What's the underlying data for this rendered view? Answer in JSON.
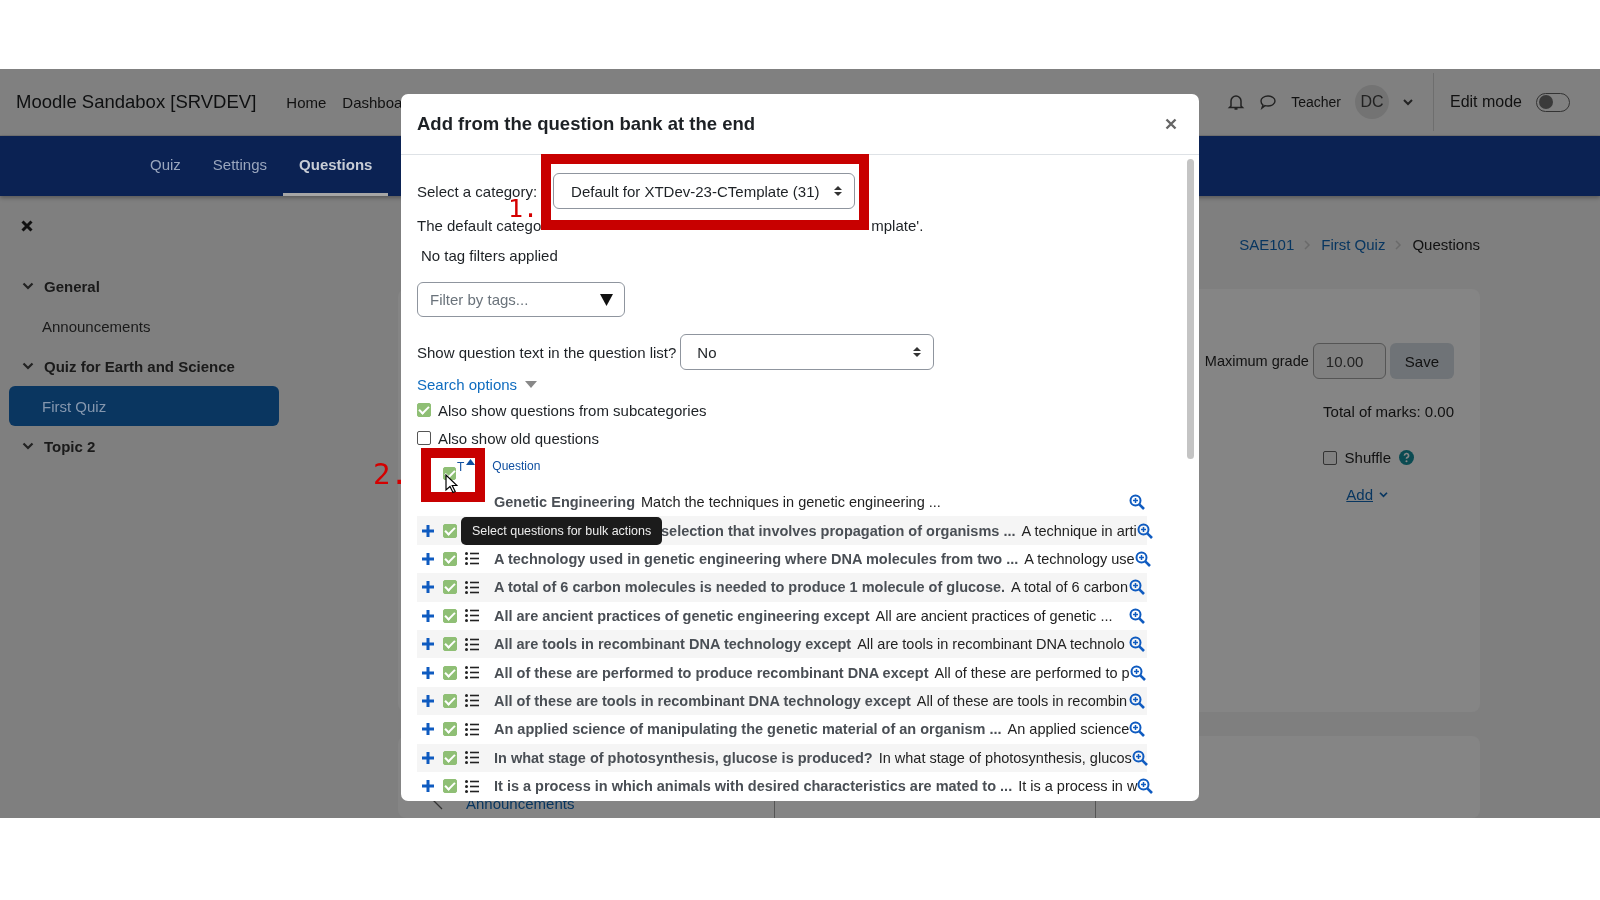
{
  "site_name": "Moodle Sandabox [SRVDEV]",
  "primary_nav": [
    "Home",
    "Dashboa"
  ],
  "user_menu": {
    "name": "Teacher",
    "initials": "DC"
  },
  "edit_mode": {
    "label": "Edit mode",
    "on": false
  },
  "secondary_nav": [
    {
      "label": "Quiz",
      "selected": false
    },
    {
      "label": "Settings",
      "selected": false
    },
    {
      "label": "Questions",
      "selected": true
    }
  ],
  "course_index": [
    {
      "label": "General",
      "children": [
        {
          "label": "Announcements",
          "selected": false
        }
      ]
    },
    {
      "label": "Quiz for Earth and Science",
      "children": [
        {
          "label": "First Quiz",
          "selected": true
        }
      ]
    },
    {
      "label": "Topic 2"
    }
  ],
  "breadcrumb": [
    {
      "label": "SAE101",
      "current": false
    },
    {
      "label": "First Quiz",
      "current": false
    },
    {
      "label": "Questions",
      "current": true
    }
  ],
  "quiz_edit": {
    "max_grade_label": "Maximum grade",
    "max_grade": "10.00",
    "save": "Save",
    "total_marks": "Total of marks: 0.00",
    "shuffle": {
      "label": "Shuffle",
      "checked": false
    },
    "add": "Add"
  },
  "footer_nav": {
    "link": "Announcements"
  },
  "modal": {
    "title": "Add from the question bank at the end",
    "category_label": "Select a category:",
    "category_value": "Default for XTDev-23-CTemplate (31)",
    "category_note": [
      "The default catego",
      "mplate'."
    ],
    "tag_status": "No tag filters applied",
    "tag_filter_placeholder": "Filter by tags...",
    "show_text_label": "Show question text in the question list?",
    "show_text_value": "No",
    "search_options": "Search options",
    "options": [
      {
        "label": "Also show questions from subcategories",
        "checked": true
      },
      {
        "label": "Also show old questions",
        "checked": false
      }
    ],
    "header": {
      "select_all_checked": true,
      "sort_label": "T",
      "question_label": "Question"
    },
    "tooltip": "Select questions for bulk actions",
    "questions": [
      {
        "kind": "under-annotation",
        "title": "Genetic Engineering",
        "text": "Match the techniques in genetic engineering ..."
      },
      {
        "kind": "under-tooltip",
        "checked": true,
        "title": "selection that involves propagation of organisms ...",
        "text": "A technique in arti"
      },
      {
        "kind": "normal",
        "checked": true,
        "title": "A technology used in genetic engineering where DNA molecules from two ...",
        "text": "A technology use"
      },
      {
        "kind": "normal",
        "checked": true,
        "title": "A total of 6 carbon molecules is needed to produce 1 molecule of glucose.",
        "text": "A total of 6 carbon"
      },
      {
        "kind": "normal",
        "checked": true,
        "title": "All are ancient practices of genetic engineering except",
        "text": "All are ancient practices of genetic ..."
      },
      {
        "kind": "normal",
        "checked": true,
        "title": "All are tools in recombinant DNA technology except",
        "text": "All are tools in recombinant DNA technolo"
      },
      {
        "kind": "normal",
        "checked": true,
        "title": "All of these are performed to produce recombinant DNA except",
        "text": "All of these are performed to p"
      },
      {
        "kind": "normal",
        "checked": true,
        "title": "All of these are tools in recombinant DNA technology except",
        "text": "All of these are tools in recombin"
      },
      {
        "kind": "normal",
        "checked": true,
        "title": "An applied science of manipulating the genetic material of an organism ...",
        "text": "An applied science"
      },
      {
        "kind": "normal",
        "checked": true,
        "title": "In what stage of photosynthesis, glucose is produced?",
        "text": "In what stage of photosynthesis, glucos"
      },
      {
        "kind": "normal",
        "checked": true,
        "title": "It is a process in which animals with desired characteristics are mated to ...",
        "text": "It is a process in w"
      }
    ],
    "annotations": [
      "1.",
      "2."
    ]
  }
}
